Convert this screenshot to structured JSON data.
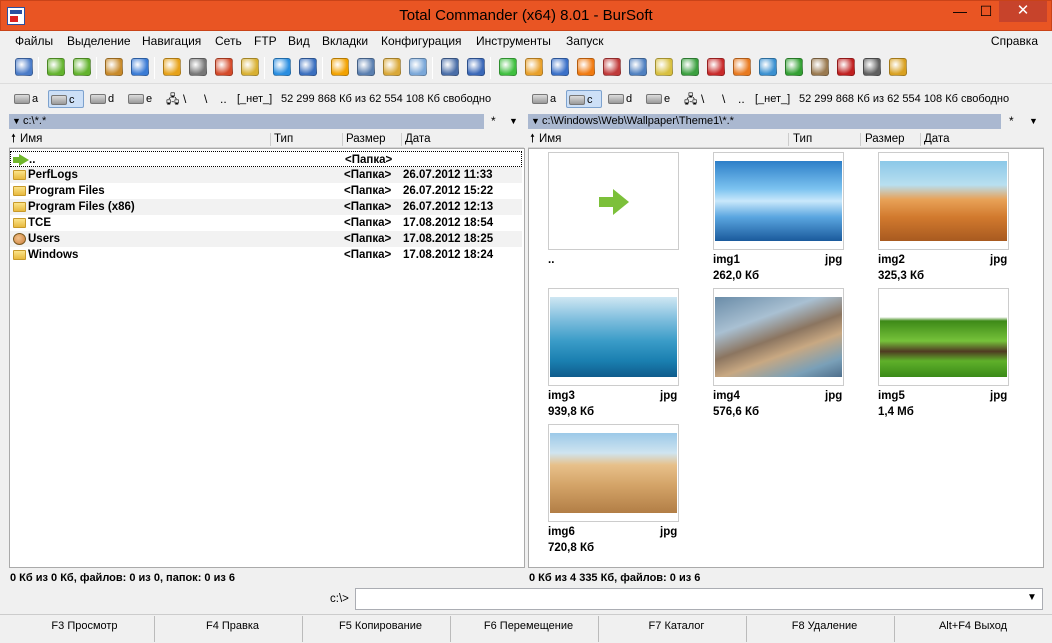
{
  "window": {
    "title": "Total Commander (x64) 8.01 - BurSoft",
    "minimize_glyph": "—",
    "maximize_glyph": "☐",
    "close_glyph": "✕"
  },
  "menu": {
    "items": [
      "Файлы",
      "Выделение",
      "Навигация",
      "Сеть",
      "FTP",
      "Вид",
      "Вкладки",
      "Конфигурация",
      "Инструменты",
      "Запуск"
    ],
    "help": "Справка"
  },
  "toolbar": {
    "icons": [
      "refresh-icon",
      "back-arrow-icon",
      "forward-arrow-icon",
      "pack-icon",
      "unpack-icon",
      "favorite-star-icon",
      "edit-icon",
      "chart-icon",
      "notepad-icon",
      "ie-icon",
      "globe-icon",
      "warning-icon",
      "search-icon",
      "archive-icon",
      "document-icon",
      "picture-icon",
      "compare-icon",
      "green-circle-icon",
      "media-icon",
      "play-icon",
      "vlc-icon",
      "disc-icon",
      "magnifier-icon",
      "notes-icon",
      "chrome-icon",
      "opera-icon",
      "firefox-icon",
      "download-icon",
      "torrent-icon",
      "cd-icon",
      "aida-icon",
      "cmd-icon",
      "tools-icon"
    ],
    "icon_colors": [
      "#4a7bc8",
      "#63b32e",
      "#63b32e",
      "#c88a2a",
      "#3a7bd5",
      "#e6a21a",
      "#777777",
      "#d44a2a",
      "#d8b032",
      "#2a8ee0",
      "#3a6fbf",
      "#f2a200",
      "#5a7fb0",
      "#d9a838",
      "#7aa7d8",
      "#4a6ea8",
      "#3a68b8",
      "#3fbf3f",
      "#e8a02a",
      "#3a70c8",
      "#f07a10",
      "#c03a3a",
      "#4f80c0",
      "#d8c040",
      "#3ba040",
      "#c82a2a",
      "#e87a20",
      "#3a90d0",
      "#33a033",
      "#9a7a50",
      "#c02020",
      "#606060",
      "#d8a020"
    ]
  },
  "drives": {
    "left": [
      {
        "letter": "a"
      },
      {
        "letter": "c"
      },
      {
        "letter": "d"
      },
      {
        "letter": "e"
      }
    ],
    "right": [
      {
        "letter": "a"
      },
      {
        "letter": "c"
      },
      {
        "letter": "d"
      },
      {
        "letter": "e"
      }
    ],
    "net_symbol": "\\",
    "root_symbol": "\\",
    "up_symbol": "..",
    "left_label": "[_нет_]",
    "right_label": "[_нет_]",
    "left_free": "52 299 868 Кб из 62 554 108 Кб свободно",
    "right_free": "52 299 868 Кб из 62 554 108 Кб свободно"
  },
  "left_panel": {
    "path": "c:\\*.*",
    "star": "*",
    "dropdown": "▼",
    "columns": {
      "name": "Имя",
      "type": "Тип",
      "size": "Размер",
      "date": "Дата"
    },
    "rows": [
      {
        "name": "..",
        "size": "<Папка>",
        "date": "",
        "icon": "up-arrow"
      },
      {
        "name": "PerfLogs",
        "size": "<Папка>",
        "date": "26.07.2012 11:33",
        "icon": "folder"
      },
      {
        "name": "Program Files",
        "size": "<Папка>",
        "date": "26.07.2012 15:22",
        "icon": "folder"
      },
      {
        "name": "Program Files (x86)",
        "size": "<Папка>",
        "date": "26.07.2012 12:13",
        "icon": "folder"
      },
      {
        "name": "TCE",
        "size": "<Папка>",
        "date": "17.08.2012 18:54",
        "icon": "folder"
      },
      {
        "name": "Users",
        "size": "<Папка>",
        "date": "17.08.2012 18:25",
        "icon": "users"
      },
      {
        "name": "Windows",
        "size": "<Папка>",
        "date": "17.08.2012 18:24",
        "icon": "folder"
      }
    ],
    "status": "0 Кб из 0 Кб, файлов: 0 из 0, папок: 0 из 6"
  },
  "right_panel": {
    "path": "c:\\Windows\\Web\\Wallpaper\\Theme1\\*.*",
    "star": "*",
    "dropdown": "▼",
    "columns": {
      "name": "Имя",
      "type": "Тип",
      "size": "Размер",
      "date": "Дата"
    },
    "thumbs": [
      {
        "name": "..",
        "ext": "",
        "size": "",
        "kind": "up"
      },
      {
        "name": "img1",
        "ext": "jpg",
        "size": "262,0 Кб",
        "kind": "ice"
      },
      {
        "name": "img2",
        "ext": "jpg",
        "size": "325,3 Кб",
        "kind": "hills"
      },
      {
        "name": "img3",
        "ext": "jpg",
        "size": "939,8 Кб",
        "kind": "sea"
      },
      {
        "name": "img4",
        "ext": "jpg",
        "size": "576,6 Кб",
        "kind": "rocks"
      },
      {
        "name": "img5",
        "ext": "jpg",
        "size": "1,4 Мб",
        "kind": "field"
      },
      {
        "name": "img6",
        "ext": "jpg",
        "size": "720,8 Кб",
        "kind": "dunes"
      }
    ],
    "status": "0 Кб из 4 335 Кб, файлов: 0 из 6"
  },
  "command_line": {
    "label": "c:\\>",
    "value": "",
    "dropdown": "▼"
  },
  "fkeys": [
    "F3 Просмотр",
    "F4 Правка",
    "F5 Копирование",
    "F6 Перемещение",
    "F7 Каталог",
    "F8 Удаление",
    "Alt+F4 Выход"
  ]
}
